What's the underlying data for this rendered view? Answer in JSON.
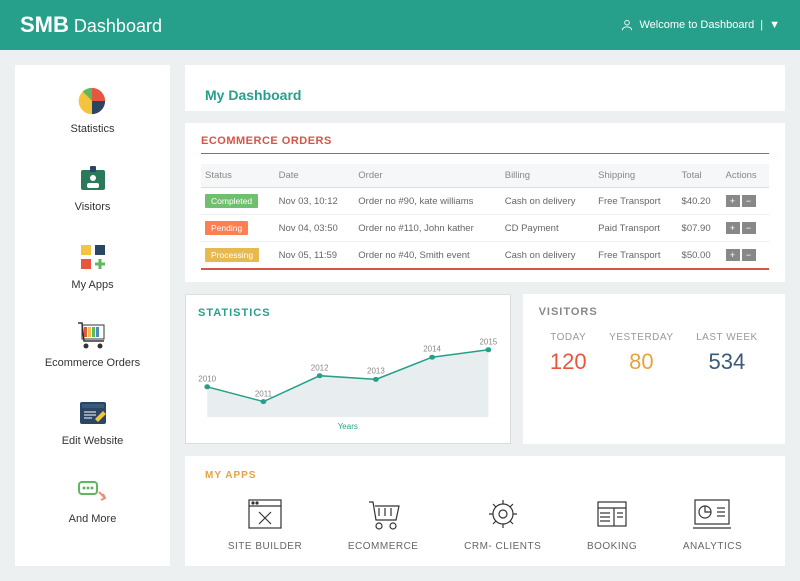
{
  "header": {
    "brand_bold": "SMB",
    "brand_light": "Dashboard",
    "welcome": "Welcome to Dashboard"
  },
  "sidebar": {
    "items": [
      {
        "label": "Statistics",
        "icon": "pie-chart-icon"
      },
      {
        "label": "Visitors",
        "icon": "badge-icon"
      },
      {
        "label": "My Apps",
        "icon": "apps-grid-icon"
      },
      {
        "label": "Ecommerce Orders",
        "icon": "cart-color-icon"
      },
      {
        "label": "Edit Website",
        "icon": "edit-page-icon"
      },
      {
        "label": "And More",
        "icon": "more-icon"
      }
    ]
  },
  "page_title": "My Dashboard",
  "orders": {
    "title": "ECOMMERCE ORDERS",
    "headers": [
      "Status",
      "Date",
      "Order",
      "Billing",
      "Shipping",
      "Total",
      "Actions"
    ],
    "rows": [
      {
        "status": "Completed",
        "date": "Nov 03, 10:12",
        "order": "Order no #90, kate williams",
        "billing": "Cash on delivery",
        "shipping": "Free Transport",
        "total": "$40.20"
      },
      {
        "status": "Pending",
        "date": "Nov 04, 03:50",
        "order": "Order no #110, John kather",
        "billing": "CD Payment",
        "shipping": "Paid Transport",
        "total": "$07.90"
      },
      {
        "status": "Processing",
        "date": "Nov 05, 11:59",
        "order": "Order no #40, Smith event",
        "billing": "Cash on delivery",
        "shipping": "Free Transport",
        "total": "$50.00"
      }
    ]
  },
  "statistics": {
    "title": "STATISTICS",
    "xlabel": "Years"
  },
  "chart_data": {
    "type": "line",
    "x": [
      2010,
      2011,
      2012,
      2013,
      2014,
      2015
    ],
    "values": [
      30,
      10,
      45,
      40,
      70,
      80
    ],
    "xlabel": "Years",
    "ylim": [
      0,
      100
    ]
  },
  "visitors": {
    "title": "VISITORS",
    "stats": [
      {
        "label": "TODAY",
        "value": "120",
        "color": "#e8563f"
      },
      {
        "label": "YESTERDAY",
        "value": "80",
        "color": "#e8a23e"
      },
      {
        "label": "LAST WEEK",
        "value": "534",
        "color": "#3a5a7a"
      }
    ]
  },
  "apps": {
    "title": "MY APPS",
    "items": [
      {
        "label": "SITE BUILDER",
        "icon": "site-builder-icon"
      },
      {
        "label": "ECOMMERCE",
        "icon": "ecommerce-icon"
      },
      {
        "label": "CRM- CLIENTS",
        "icon": "crm-icon"
      },
      {
        "label": "BOOKING",
        "icon": "booking-icon"
      },
      {
        "label": "ANALYTICS",
        "icon": "analytics-icon"
      }
    ]
  }
}
